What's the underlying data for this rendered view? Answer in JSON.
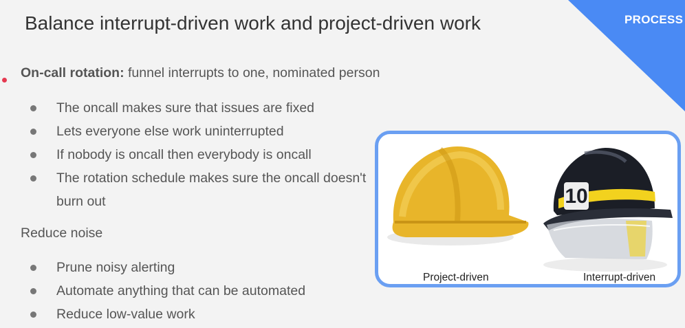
{
  "slide": {
    "title": "Balance interrupt-driven work and project-driven work",
    "tag": "PROCESS",
    "lead": {
      "bold": "On-call rotation:",
      "text": " funnel interrupts to one, nominated person"
    },
    "bullets_1": [
      "The oncall makes sure that issues are fixed",
      "Lets everyone else work uninterrupted",
      "If nobody is oncall then everybody is oncall",
      "The rotation schedule makes sure the oncall doesn't burn out"
    ],
    "subheading": "Reduce noise",
    "bullets_2": [
      "Prune noisy alerting",
      "Automate anything that can be automated",
      "Reduce low-value work"
    ],
    "photo": {
      "left_caption": "Project-driven",
      "right_caption": "Interrupt-driven",
      "helmet_number": "10"
    },
    "colors": {
      "corner": "#4a8af4",
      "photo_border": "#6a9ff2",
      "red_dot": "#e53950",
      "hard_hat": "#e8b52a",
      "fire_helmet": "#1b1e26",
      "reflective_band": "#f2d21e"
    }
  }
}
